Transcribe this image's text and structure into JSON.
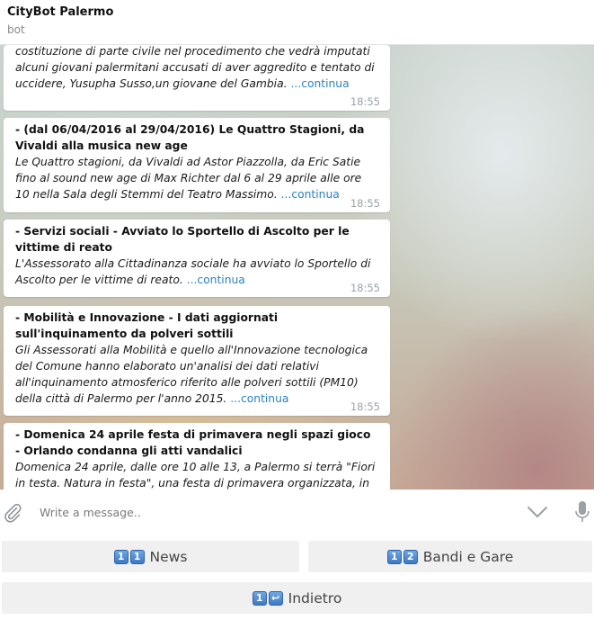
{
  "header": {
    "title": "CityBot Palermo",
    "subtitle": "bot"
  },
  "messages": [
    {
      "title": "",
      "body": "costituzione di parte civile nel procedimento che vedrà imputati alcuni giovani palermitani accusati di aver aggredito e tentato di uccidere, Yusupha Susso,un giovane del Gambia.",
      "link": "...continua",
      "time": "18:55"
    },
    {
      "title": "- (dal 06/04/2016 al 29/04/2016) Le Quattro Stagioni, da Vivaldi alla musica new age",
      "body": "Le Quattro stagioni, da Vivaldi ad Astor Piazzolla, da Eric Satie fino al sound new age di Max Richter dal 6 al 29 aprile alle ore 10 nella Sala degli Stemmi del Teatro Massimo.",
      "link": "...continua",
      "time": "18:55"
    },
    {
      "title": "- Servizi sociali - Avviato lo Sportello di Ascolto per le vittime di reato",
      "body": "L'Assessorato alla Cittadinanza sociale ha avviato lo Sportello di Ascolto per le vittime di reato.",
      "link": "...continua",
      "time": "18:55"
    },
    {
      "title": "- Mobilità e Innovazione - I dati aggiornati sull'inquinamento da polveri sottili",
      "body": "Gli Assessorati alla Mobilità e quello all'Innovazione tecnologica del Comune hanno elaborato un'analisi dei dati relativi all'inquinamento atmosferico riferito alle polveri sottili (PM10) della città di Palermo per l'anno 2015.",
      "link": "...continua",
      "time": "18:55"
    },
    {
      "title": "- Domenica 24 aprile festa di primavera negli spazi gioco - Orlando condanna gli atti vandalici",
      "body": "Domenica 24 aprile, dalle ore 10 alle 13, a Palermo si terrà \"Fiori in testa. Natura in festa\", una festa di primavera organizzata, in",
      "link": "",
      "time": ""
    }
  ],
  "composer": {
    "placeholder": "Write a message.."
  },
  "keyboard": {
    "news": {
      "keys": [
        "1",
        "1"
      ],
      "label": "News"
    },
    "bandi": {
      "keys": [
        "1",
        "2"
      ],
      "label": "Bandi e Gare"
    },
    "indietro": {
      "keys": [
        "1",
        "↩"
      ],
      "label": "Indietro"
    }
  },
  "icons": {
    "attach": "paperclip-icon",
    "chevron": "chevron-down-icon",
    "mic": "microphone-icon"
  },
  "colors": {
    "link": "#2b83c4",
    "key_blue": "#3e78c2"
  }
}
